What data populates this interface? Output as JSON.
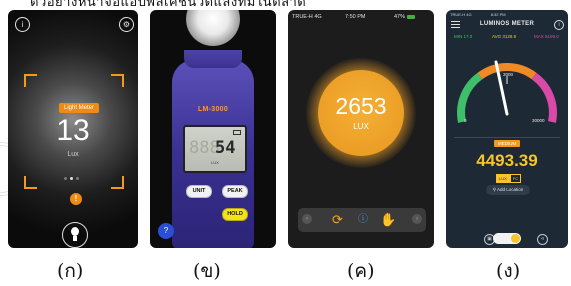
{
  "header_text": "ตัวอย่างหน้าจอแอปพลิเคชันวัดแสงที่มีในตลาด",
  "captions": [
    "(ก)",
    "(ข)",
    "(ค)",
    "(ง)"
  ],
  "phone1": {
    "badge": "Light Meter",
    "value": "13",
    "unit": "Lux",
    "icons": [
      "info-icon",
      "gear-icon",
      "warning-icon",
      "bulb-icon"
    ],
    "accent": "#f08a14"
  },
  "phone2": {
    "model": "LM-3000",
    "ghost_digits": "888",
    "reading": "54",
    "lcd_unit": "LUX",
    "buttons": {
      "unit": "UNIT",
      "peak": "PEAK",
      "hold": "HOLD"
    },
    "body_color": "#3a3092",
    "hold_color": "#f3e31c"
  },
  "phone3": {
    "status": {
      "carrier": "TRUE-H",
      "network": "4G",
      "time": "7:50 PM",
      "battery": "47%"
    },
    "value": "2653",
    "unit": "LUX",
    "toolbar_icons": [
      "refresh-icon",
      "info-icon",
      "hand-icon"
    ],
    "accent": "#e8961f"
  },
  "phone4": {
    "status": {
      "carrier": "TRUE-H",
      "network": "4G",
      "time": "8:32 PM"
    },
    "title": "LUMINOS METER",
    "min": "MIN 17.0",
    "avg": "AVG 3128.9",
    "max": "MAX 8199.0",
    "gauge_labels": [
      "0",
      "3000",
      "30000"
    ],
    "level_badge": "MEDIUM",
    "value": "4493.39",
    "unit_options": [
      "LUX",
      "FC"
    ],
    "selected_unit": "LUX",
    "add_location": "Add Location",
    "colors": {
      "min": "#3fbf6a",
      "avg": "#f7c42a",
      "max": "#d94aa8"
    }
  }
}
